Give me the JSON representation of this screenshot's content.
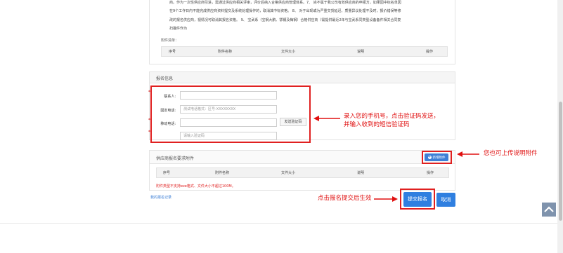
{
  "notice": {
    "text": "商。作为一次性供应商引进，需通过供应商相关评审，评价后纳入合格供应商管理体系。7、 尚不属于我公司有效供应商的申报方，如果因中标名单因\n在9个工作日内不能完成供应商资料提交及系统处理操作的，取消其中标资格。 8、 对于出现或为严重交货延迟、质量异议处理不及时，报价错误等修\n改的报名供应商，视情况可取消其报名资格。 9、 宝武系（宝钢大鹏、鄂钢及梅钢）合格供应商（需提供最近2年与宝武系同类型设备备件相关合同复\n扫描件作为",
    "attach_label": "附件清单：",
    "columns": [
      "序号",
      "附件名称",
      "文件大小",
      "说明",
      "操作"
    ]
  },
  "registration": {
    "title": "报名信息",
    "contact_label": "联系人:",
    "phone_label": "固定电话:",
    "phone_placeholder": "测试电话格式：区号-XXXXXXXX",
    "mobile_label": "移动电话:",
    "send_code_button": "发送验证码",
    "code_placeholder": "请输入验证码",
    "annotation_line1": "录入您的手机号，点击验证码发送，",
    "annotation_line2": "并输入收到的短信验证码"
  },
  "supplier": {
    "title": "供应商报名要求附件",
    "add_button": "新增附件",
    "columns": [
      "序号",
      "附件名称",
      "文件大小",
      "说明",
      "操作"
    ],
    "warning": "附件类型不支持exe格式、文件大小不超过100M。",
    "annotation": "您也可上传说明附件"
  },
  "footer": {
    "my_records": "我的报名记录",
    "submit_button": "提交报名",
    "cancel_button": "取消",
    "annotation": "点击报名提交后生效"
  },
  "colors": {
    "accent": "#2f7fe0",
    "annotation_red": "#e01010"
  },
  "icons": {
    "back_to_top": "chevron-up-icon"
  }
}
